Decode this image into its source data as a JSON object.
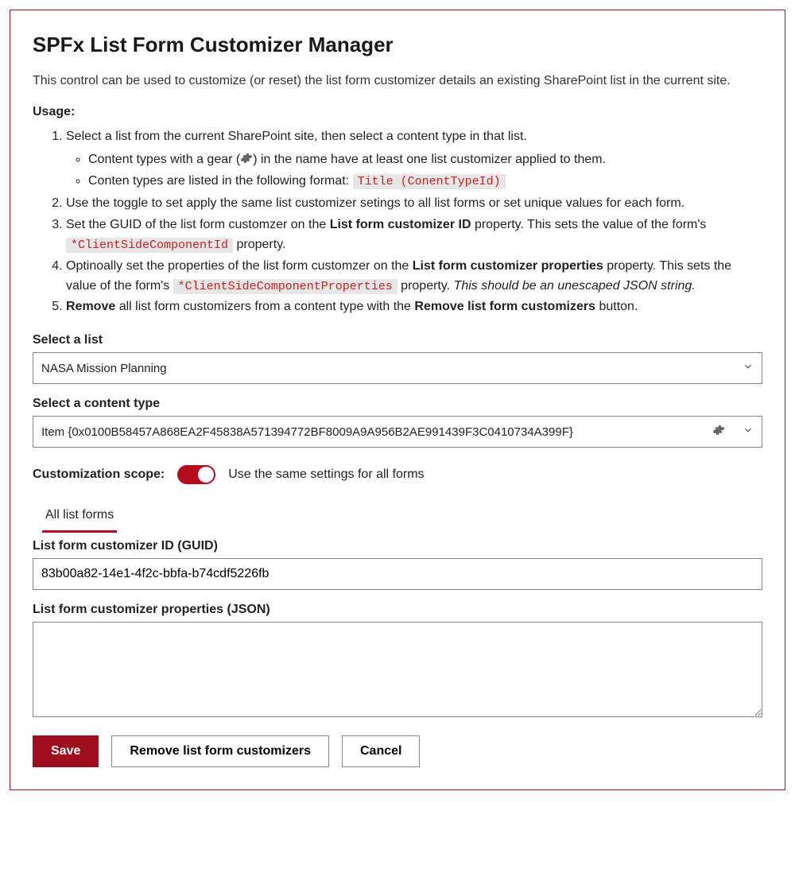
{
  "title": "SPFx List Form Customizer Manager",
  "description": "This control can be used to customize (or reset) the list form customizer details an existing SharePoint list in the current site.",
  "usage_heading": "Usage:",
  "usage": {
    "item1": "Select a list from the current SharePoint site, then select a content type in that list.",
    "item1a_pre": "Content types with a gear (",
    "item1a_post": ") in the name have at least one list customizer applied to them.",
    "item1b_pre": "Conten types are listed in the following format: ",
    "item1b_code": "Title (ConentTypeId)",
    "item2": "Use the toggle to set apply the same list customizer setings to all list forms or set unique values for each form.",
    "item3_pre": "Set the GUID of the list form customzer on the ",
    "item3_bold": "List form customizer ID",
    "item3_mid": " property. This sets the value of the form's ",
    "item3_code": "*ClientSideComponentId",
    "item3_post": " property.",
    "item4_pre": "Optinoally set the properties of the list form customzer on the ",
    "item4_bold": "List form customizer properties",
    "item4_mid": " property. This sets the value of the form's ",
    "item4_code": "*ClientSideComponentProperties",
    "item4_post1": " property. ",
    "item4_italic": "This should be an unescaped JSON string.",
    "item5_bold1": "Remove",
    "item5_mid": " all list form customizers from a content type with the ",
    "item5_bold2": "Remove list form customizers",
    "item5_post": " button."
  },
  "fields": {
    "select_list_label": "Select a list",
    "select_list_value": "NASA Mission Planning",
    "select_ct_label": "Select a content type",
    "select_ct_value": "Item {0x0100B58457A868EA2F45838A571394772BF8009A9A956B2AE991439F3C0410734A399F}",
    "scope_label": "Customization scope:",
    "scope_toggle_text": "Use the same settings for all forms",
    "scope_toggle_on": true,
    "tab_label": "All list forms",
    "guid_label": "List form customizer ID (GUID)",
    "guid_value": "83b00a82-14e1-4f2c-bbfa-b74cdf5226fb",
    "props_label": "List form customizer properties (JSON)",
    "props_value": ""
  },
  "buttons": {
    "save": "Save",
    "remove": "Remove list form customizers",
    "cancel": "Cancel"
  }
}
